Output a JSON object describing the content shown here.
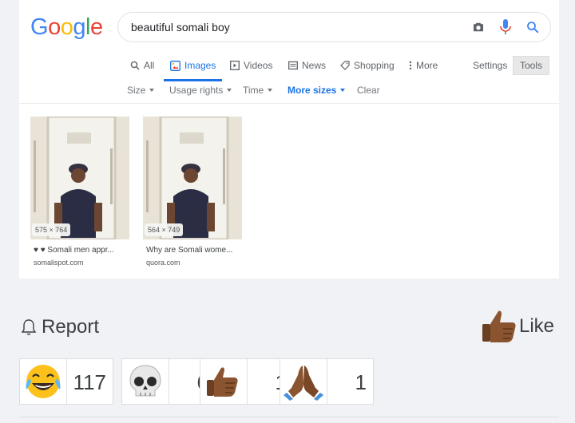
{
  "logo": {
    "letters": [
      "G",
      "o",
      "o",
      "g",
      "l",
      "e"
    ],
    "colors": [
      "#4285F4",
      "#EA4335",
      "#FBBC05",
      "#4285F4",
      "#34A853",
      "#EA4335"
    ]
  },
  "search": {
    "query": "beautiful somali boy"
  },
  "tabs": [
    {
      "label": "All",
      "icon": "search-icon"
    },
    {
      "label": "Images",
      "icon": "image-icon",
      "active": true
    },
    {
      "label": "Videos",
      "icon": "video-icon"
    },
    {
      "label": "News",
      "icon": "news-icon"
    },
    {
      "label": "Shopping",
      "icon": "tag-icon"
    },
    {
      "label": "More",
      "icon": "more-vert-icon"
    }
  ],
  "settings_label": "Settings",
  "tools_label": "Tools",
  "tools_row": [
    "Size",
    "Usage rights",
    "Time",
    "More sizes",
    "Clear"
  ],
  "results": [
    {
      "dims": "575 × 764",
      "title": "♥ ♥ Somali men appr...",
      "site": "somalispot.com"
    },
    {
      "dims": "564 × 749",
      "title": "Why are Somali wome...",
      "site": "quora.com"
    }
  ],
  "report_label": "Report",
  "like_label": "Like",
  "reactions": [
    {
      "emoji": "face-with-tears-of-joy",
      "count": "117"
    },
    {
      "emoji": "skull",
      "count": "6"
    },
    {
      "emoji": "thumbs-up",
      "count": "1"
    },
    {
      "emoji": "folded-hands",
      "count": "1"
    }
  ],
  "accent": "#1a73e8"
}
